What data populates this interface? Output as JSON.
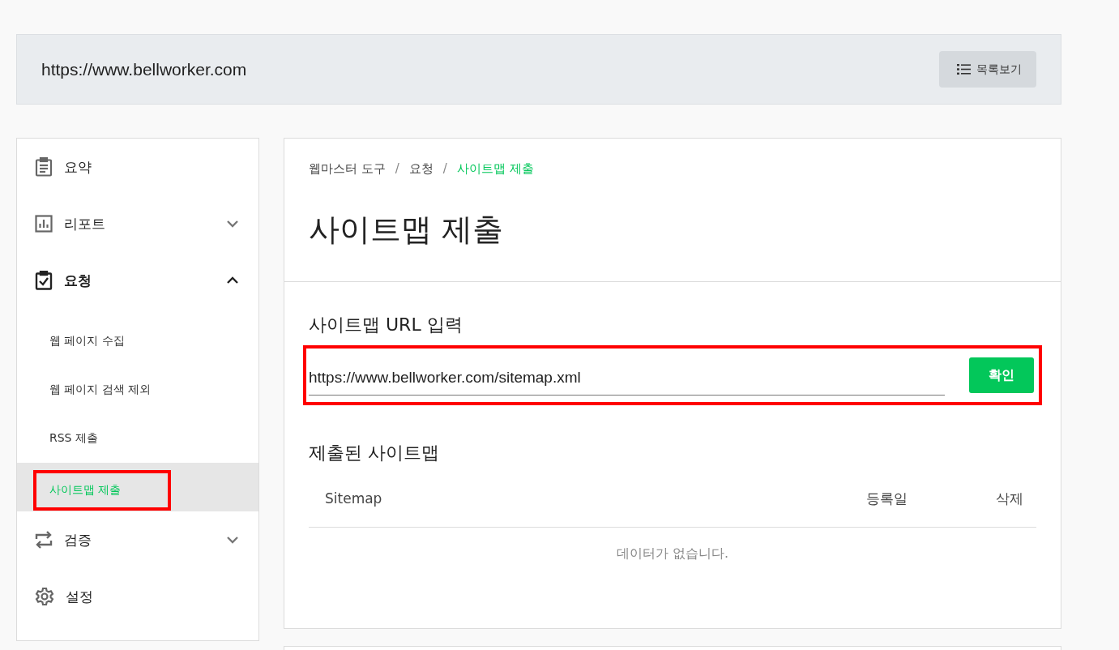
{
  "header": {
    "site_url": "https://www.bellworker.com",
    "list_button": "목록보기"
  },
  "sidebar": {
    "items": [
      {
        "label": "요약",
        "selected": false
      },
      {
        "label": "리포트",
        "selected": false,
        "expanded": false
      },
      {
        "label": "요청",
        "selected": true,
        "expanded": true,
        "children": [
          {
            "label": "웹 페이지 수집",
            "selected": false
          },
          {
            "label": "웹 페이지 검색 제외",
            "selected": false
          },
          {
            "label": "RSS 제출",
            "selected": false
          },
          {
            "label": "사이트맵 제출",
            "selected": true
          }
        ]
      },
      {
        "label": "검증",
        "selected": false,
        "expanded": false
      },
      {
        "label": "설정",
        "selected": false
      }
    ]
  },
  "breadcrumb": {
    "separator": "/",
    "items": [
      "웹마스터 도구",
      "요청",
      "사이트맵 제출"
    ]
  },
  "page_title": "사이트맵 제출",
  "url_form": {
    "label": "사이트맵 URL 입력",
    "value": "https://www.bellworker.com/sitemap.xml",
    "button": "확인"
  },
  "submitted": {
    "title": "제출된 사이트맵",
    "columns": [
      "Sitemap",
      "등록일",
      "삭제"
    ],
    "empty_message": "데이터가 없습니다."
  }
}
